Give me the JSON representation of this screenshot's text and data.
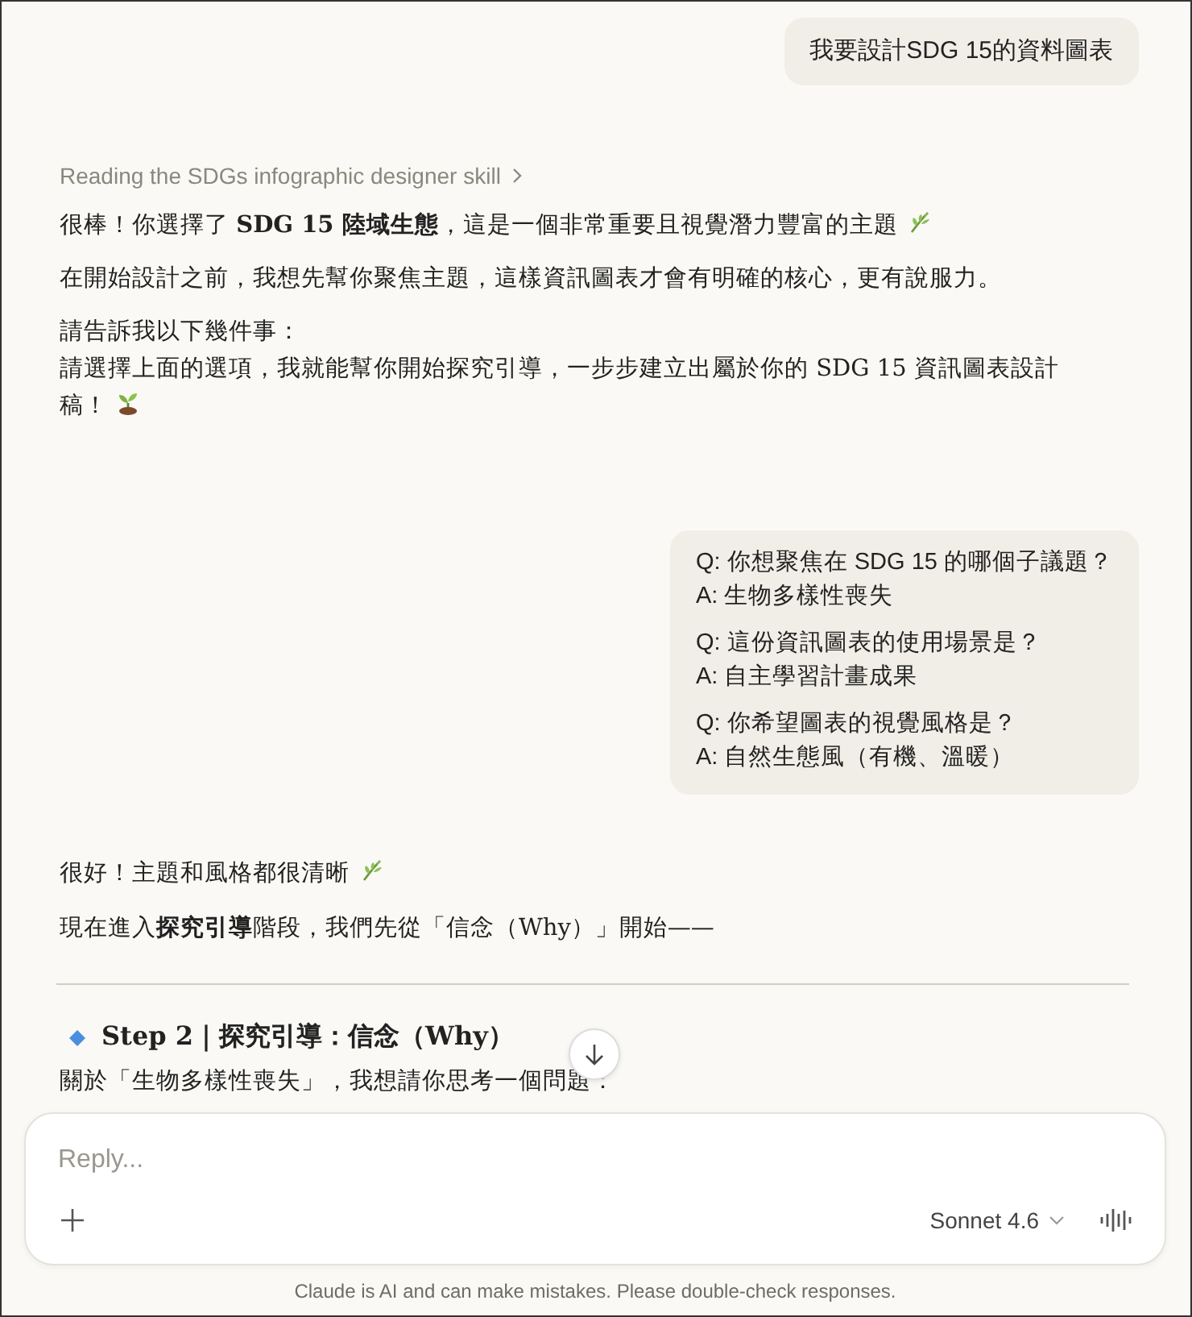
{
  "messages": [
    {
      "kind": "user",
      "text": "我要設計SDG 15的資料圖表"
    },
    {
      "kind": "assistant",
      "skill": "Reading the SDGs infographic designer skill",
      "blocks": [
        {
          "kind": "leafnote",
          "lines": [
            "很棒！你選擇了 **SDG 15 陸域生態**，這是一個非常重要且視覺潛力豐富的主題"
          ]
        },
        {
          "kind": "paragraph",
          "lines": [
            "在開始設計之前，我想先幫你聚焦主題，這樣資訊圖表才會有明確的核心，更有說服力。"
          ]
        },
        {
          "kind": "sproutnote",
          "lines": [
            "請告訴我以下幾件事：",
            "請選擇上面的選項，我就能幫你開始探究引導，一步步建立出屬於你的 SDG 15 資訊圖表設計",
            "稿！"
          ]
        }
      ]
    },
    {
      "kind": "answers",
      "items": [
        {
          "question": "Q: 你想聚焦在 SDG 15 的哪個子議題？",
          "answer": "A: 生物多樣性喪失"
        },
        {
          "question": "Q: 這份資訊圖表的使用場景是？",
          "answer": "A: 自主學習計畫成果"
        },
        {
          "question": "Q: 你希望圖表的視覺風格是？",
          "answer": "A: 自然生態風（有機、溫暖）"
        }
      ]
    },
    {
      "kind": "assistant",
      "blocks": [
        {
          "kind": "leafnote",
          "lines": [
            "很好！主題和風格都很清晰"
          ]
        },
        {
          "kind": "paragraph",
          "lines": [
            "現在進入**探究引導**階段，我們先從「信念（Why）」開始——"
          ]
        },
        {
          "kind": "divider"
        },
        {
          "kind": "heading",
          "text": "Step 2｜探究引導：信念（Why）"
        },
        {
          "kind": "paragraph",
          "lines": [
            "關於「生物多樣性喪失」，我想請你思考一個問題："
          ]
        }
      ]
    }
  ],
  "composer": {
    "placeholder": "Reply...",
    "model": "Sonnet 4.6"
  },
  "disclaimer": "Claude is AI and can make mistakes. Please double-check responses."
}
